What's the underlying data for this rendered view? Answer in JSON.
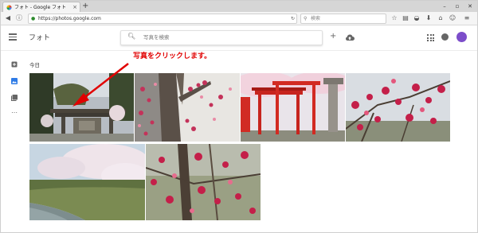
{
  "browser": {
    "tab_title": "フォト - Google フォト",
    "tab_close": "×",
    "new_tab": "+",
    "url": "https://photos.google.com",
    "search_placeholder": "検索"
  },
  "app": {
    "title": "フォト",
    "search_placeholder": "写真を検索",
    "section_label": "今日"
  },
  "annotation": {
    "text": "写真をクリックします。",
    "color": "#e10000"
  },
  "photos": [
    {
      "subject": "shrine gate with trees"
    },
    {
      "subject": "plum blossoms on trunk"
    },
    {
      "subject": "red torii gates"
    },
    {
      "subject": "red plum blossoms"
    },
    {
      "subject": "cherry blossoms by river"
    },
    {
      "subject": "plum blossoms close-up"
    }
  ],
  "icons": {
    "menu": "menu-icon",
    "search": "search-icon",
    "add": "add-icon",
    "upload": "cloud-upload-icon",
    "apps": "apps-grid-icon",
    "notifications": "notifications-icon"
  },
  "colors": {
    "accent": "#2e7be6",
    "avatar": "#7c4dca"
  }
}
